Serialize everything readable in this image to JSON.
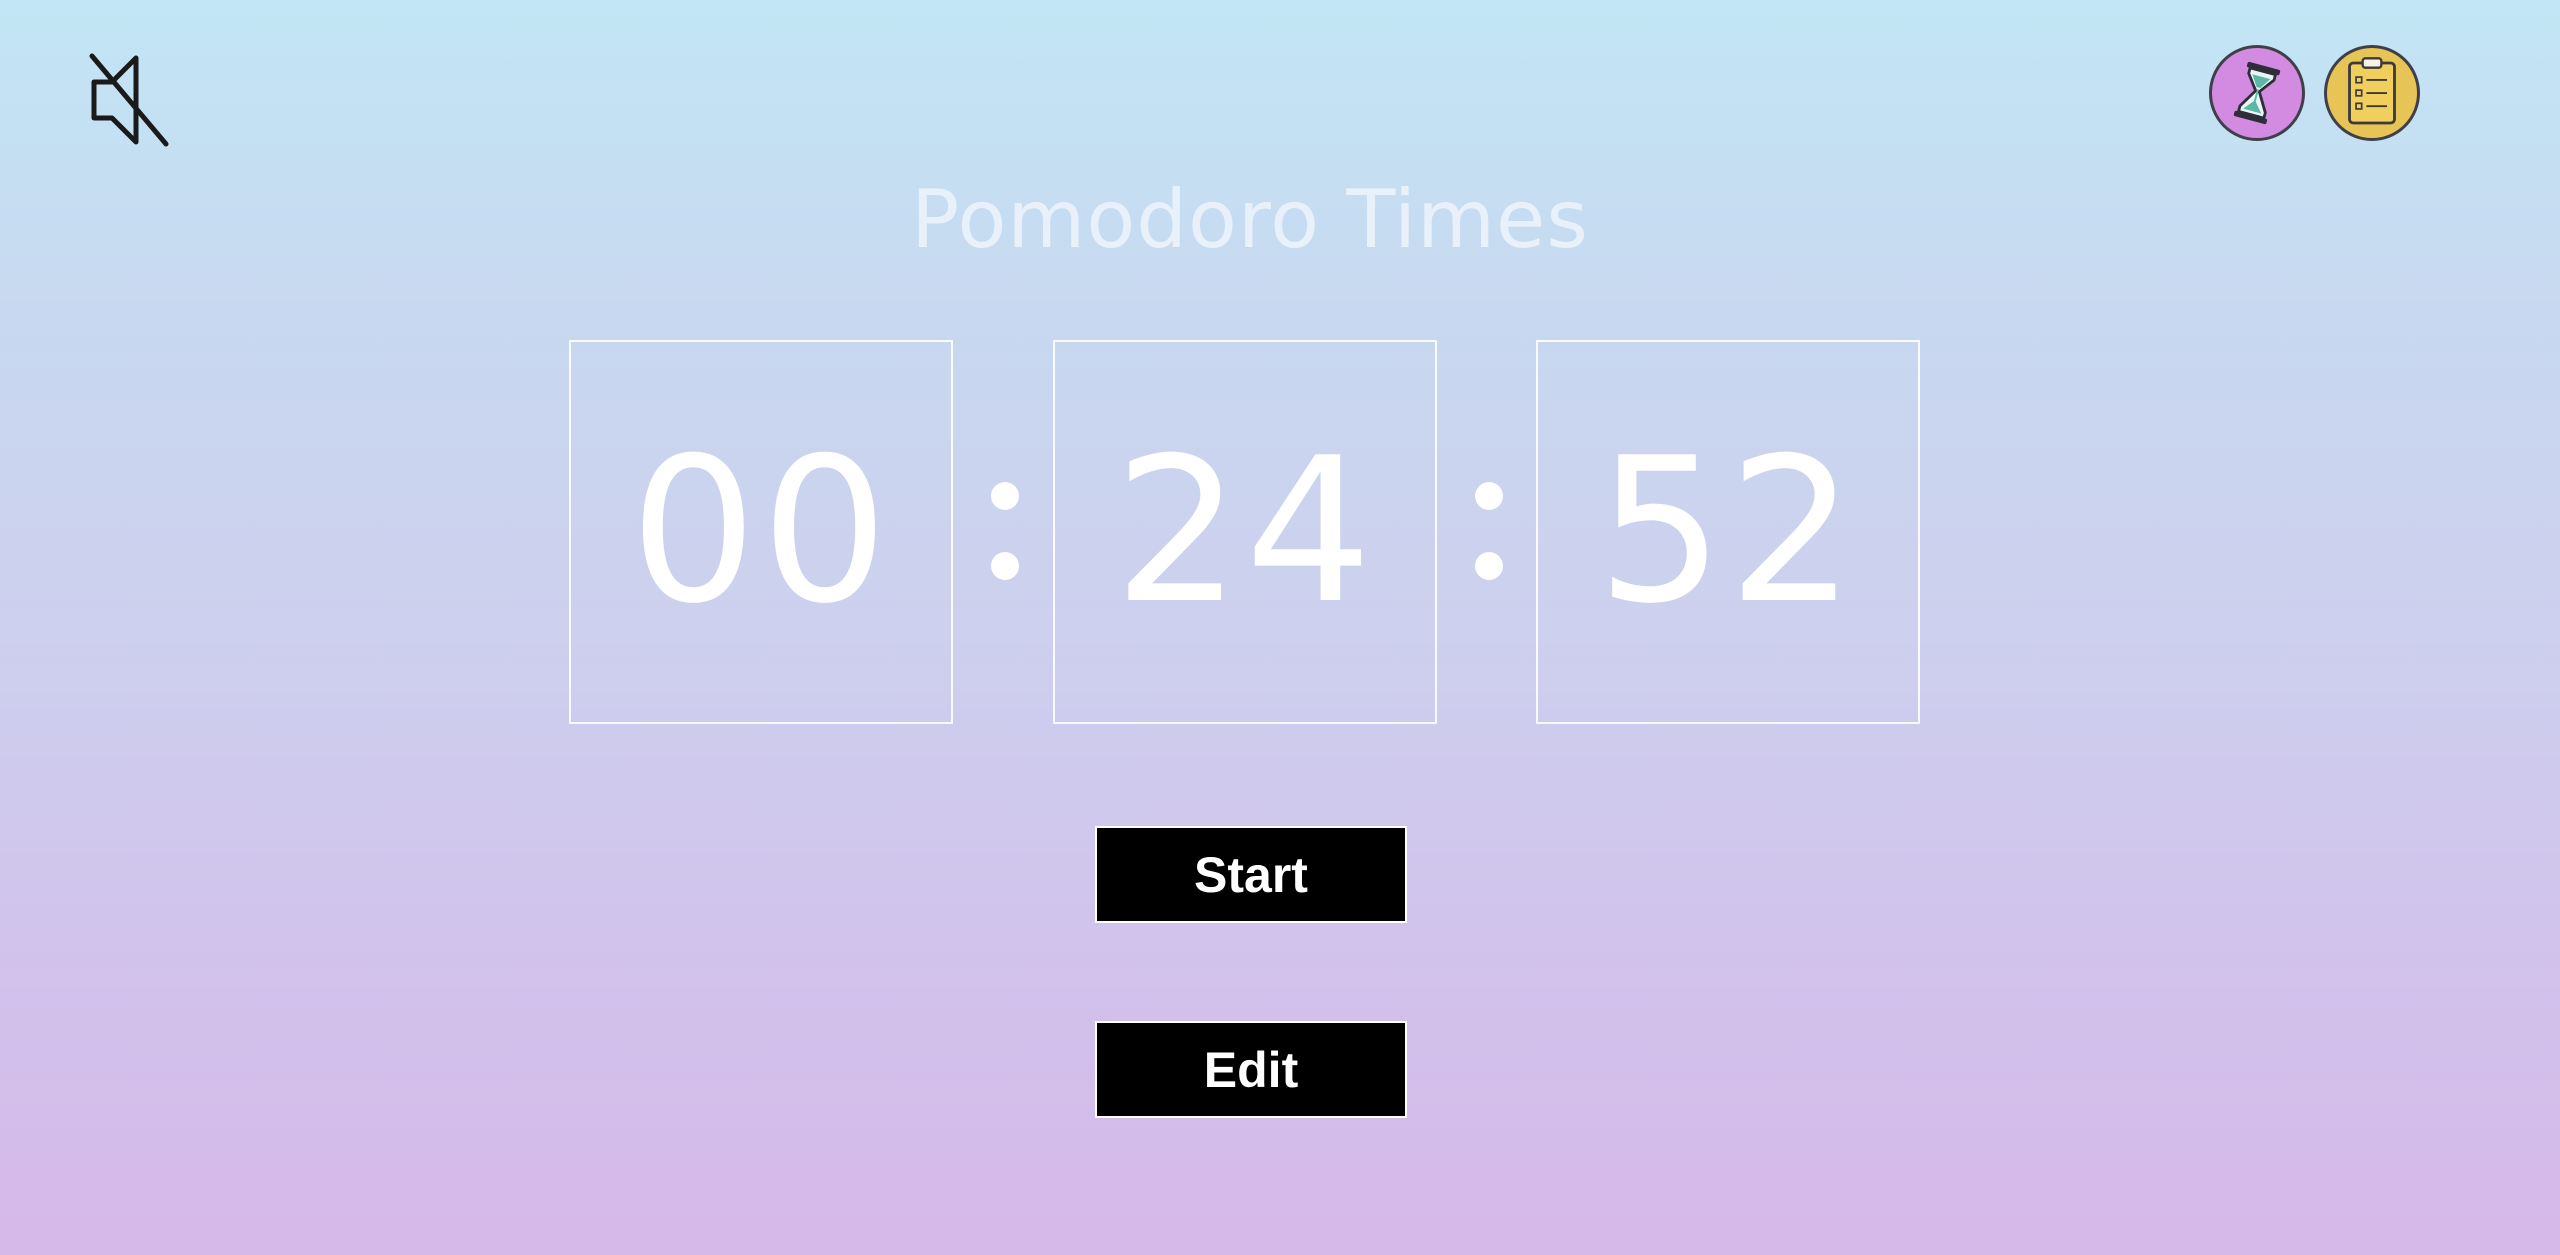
{
  "header": {
    "title": "Pomodoro Times",
    "mute_icon": "speaker-muted-icon",
    "timer_nav_icon": "hourglass-icon",
    "tasks_nav_icon": "clipboard-checklist-icon"
  },
  "timer": {
    "hours": "00",
    "minutes": "24",
    "seconds": "52"
  },
  "controls": {
    "start_label": "Start",
    "edit_label": "Edit"
  },
  "colors": {
    "gradient_top": "#c2e6f5",
    "gradient_bottom": "#d6b8e9",
    "hourglass_bg": "#d28be0",
    "clipboard_bg": "#e6c455",
    "button_bg": "#000000",
    "button_text": "#ffffff"
  }
}
